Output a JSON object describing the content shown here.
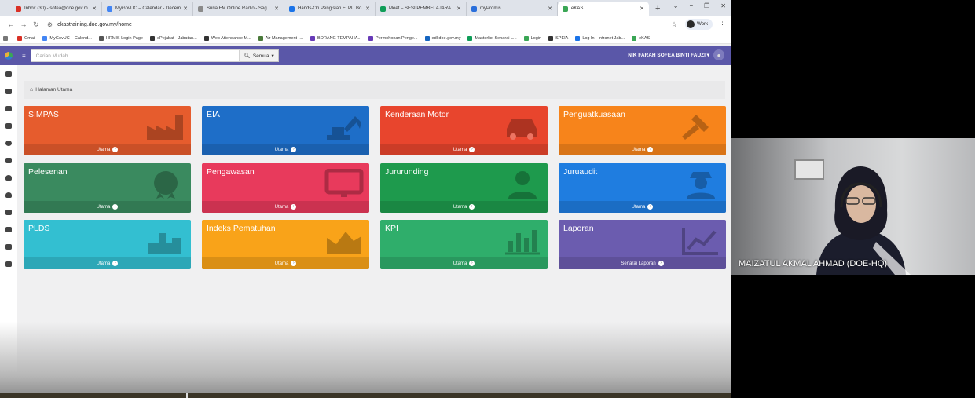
{
  "browser": {
    "tabs": [
      {
        "label": "Inbox (30) - sofea@doe.gov.m",
        "color": "#d93025",
        "active": false
      },
      {
        "label": "MyGovUC – Calendar - Decem",
        "color": "#4285f4",
        "active": false
      },
      {
        "label": "Suria FM Online Radio - Segala",
        "color": "#8a8a8a",
        "active": false
      },
      {
        "label": "Hands-On Pengisian FLPU Bo",
        "color": "#1a73e8",
        "active": false
      },
      {
        "label": "Meet – SESI PEMBELAJARA",
        "color": "#0f9d58",
        "active": false
      },
      {
        "label": "myPromis",
        "color": "#2a6fdb",
        "active": false
      },
      {
        "label": "eKAS",
        "color": "#3aa655",
        "active": true
      }
    ],
    "new_tab_label": "+",
    "url": "ekastraining.doe.gov.my/home",
    "profile_label": "Work",
    "bookmarks": [
      {
        "label": "Gmail",
        "color": "#d93025"
      },
      {
        "label": "MyGovUC – Calend...",
        "color": "#4285f4"
      },
      {
        "label": "HRMIS Login Page",
        "color": "#555555"
      },
      {
        "label": "ePejabat - Jabatan...",
        "color": "#333333"
      },
      {
        "label": "Web Attendance M...",
        "color": "#333333"
      },
      {
        "label": "Air Management -...",
        "color": "#4a7a3a"
      },
      {
        "label": "BORANG TEMPAHA...",
        "color": "#673ab7"
      },
      {
        "label": "Permohonan Penge...",
        "color": "#673ab7"
      },
      {
        "label": "edl.doe.gov.my",
        "color": "#1565c0"
      },
      {
        "label": "Masterlist Senarai L...",
        "color": "#0f9d58"
      },
      {
        "label": "Login",
        "color": "#3aa655"
      },
      {
        "label": "SPEIA",
        "color": "#333333"
      },
      {
        "label": "Log In - Intranet Jab...",
        "color": "#1a73e8"
      },
      {
        "label": "eKAS",
        "color": "#3aa655"
      }
    ]
  },
  "app": {
    "search_placeholder": "Carian Mudah",
    "search_scope": "Semua",
    "user_name": "NIK FARAH SOFEA BINTI FAUZI",
    "breadcrumb": "Halaman Utama",
    "tiles": [
      {
        "title": "SIMPAS",
        "footer": "Utama",
        "color": "#e65c2d",
        "icon": "factory-icon"
      },
      {
        "title": "EIA",
        "footer": "Utama",
        "color": "#1e6ec8",
        "icon": "excavator-icon"
      },
      {
        "title": "Kenderaan Motor",
        "footer": "Utama",
        "color": "#e8452d",
        "icon": "car-icon"
      },
      {
        "title": "Penguatkuasaan",
        "footer": "Utama",
        "color": "#f7841b",
        "icon": "gavel-icon"
      },
      {
        "title": "Pelesenan",
        "footer": "Utama",
        "color": "#3a8a5f",
        "icon": "certificate-icon"
      },
      {
        "title": "Pengawasan",
        "footer": "Utama",
        "color": "#e83a5c",
        "icon": "monitor-icon"
      },
      {
        "title": "Jururunding",
        "footer": "Utama",
        "color": "#1e9a4d",
        "icon": "consultant-icon"
      },
      {
        "title": "Juruaudit",
        "footer": "Utama",
        "color": "#1f7de0",
        "icon": "auditor-icon"
      },
      {
        "title": "PLDS",
        "footer": "Utama",
        "color": "#33bfd1",
        "icon": "plant-icon"
      },
      {
        "title": "Indeks Pematuhan",
        "footer": "Utama",
        "color": "#f9a319",
        "icon": "area-chart-icon"
      },
      {
        "title": "KPI",
        "footer": "Utama",
        "color": "#2fae6b",
        "icon": "bar-chart-icon"
      },
      {
        "title": "Laporan",
        "footer": "Senarai Laporan",
        "color": "#6b5caf",
        "icon": "line-chart-icon"
      }
    ]
  },
  "video": {
    "participant_name": "MAIZATUL AKMAL AHMAD (DOE-HQ)"
  }
}
